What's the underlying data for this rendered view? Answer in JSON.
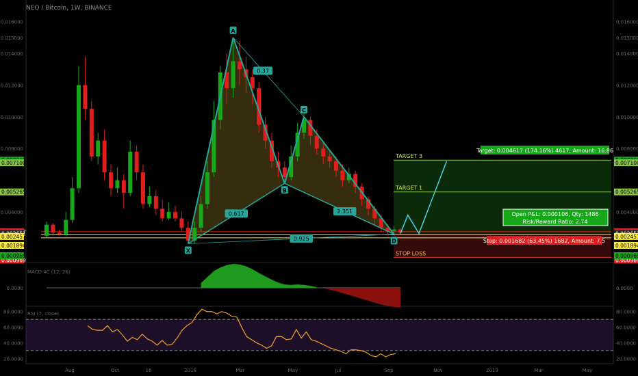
{
  "header": {
    "title": "NEO / Bitcoin, 1W, BINANCE"
  },
  "colors": {
    "up": "#17a81a",
    "down": "#e01e1e",
    "pattern": "#26a69a",
    "target": "#8bc34a",
    "stop": "#e53935",
    "rsi": "#f0a030"
  },
  "chart_data": {
    "type": "candlestick",
    "price_axis": {
      "ylim": [
        0.0009,
        0.0165
      ],
      "ticks": [
        "0.016000",
        "0.015000",
        "0.014000",
        "0.012000",
        "0.010000",
        "0.008000",
        "0.004000",
        "0.002000"
      ]
    },
    "tags_left": [
      {
        "value": "0.007268",
        "y": 0.007268,
        "bg": "#17a81a",
        "fg": "#000"
      },
      {
        "value": "0.007100",
        "y": 0.0071,
        "bg": "#8bc34a",
        "fg": "#000"
      },
      {
        "value": "0.005265",
        "y": 0.005265,
        "bg": "#8bc34a",
        "fg": "#000"
      },
      {
        "value": "0.002757",
        "y": 0.002757,
        "bg": "#e01e1e",
        "fg": "#fff"
      },
      {
        "value": "0.002651",
        "y": 0.002651,
        "bg": "#222",
        "fg": "#fff"
      },
      {
        "value": "0.002457",
        "y": 0.002457,
        "bg": "#ffeb3b",
        "fg": "#000"
      },
      {
        "value": "0.001894",
        "y": 0.001894,
        "bg": "#ffeb3b",
        "fg": "#000"
      },
      {
        "value": "0.000969",
        "y": 0.000969,
        "bg": "#e01e1e",
        "fg": "#fff"
      },
      {
        "value": "0.000969",
        "y": 0.0003,
        "bg": "#17a81a",
        "fg": "#000"
      }
    ],
    "x_ticks": [
      "Aug",
      "Oct",
      "16",
      "2018",
      "Mar",
      "May",
      "Jul",
      "Sep",
      "Nov",
      "2019",
      "Mar",
      "May"
    ],
    "candles": [
      [
        0.0025,
        0.0032,
        0.0034,
        0.0024
      ],
      [
        0.0032,
        0.0027,
        0.0033,
        0.0025
      ],
      [
        0.0027,
        0.0026,
        0.0029,
        0.0025
      ],
      [
        0.0026,
        0.0035,
        0.004,
        0.0025
      ],
      [
        0.0035,
        0.0055,
        0.0062,
        0.0033
      ],
      [
        0.0055,
        0.012,
        0.0132,
        0.0052
      ],
      [
        0.012,
        0.0105,
        0.0138,
        0.0098
      ],
      [
        0.0105,
        0.0075,
        0.011,
        0.0072
      ],
      [
        0.0075,
        0.0085,
        0.009,
        0.007
      ],
      [
        0.0085,
        0.0065,
        0.0092,
        0.006
      ],
      [
        0.0065,
        0.0055,
        0.007,
        0.005
      ],
      [
        0.0055,
        0.006,
        0.0068,
        0.0052
      ],
      [
        0.006,
        0.0052,
        0.0064,
        0.0042
      ],
      [
        0.0052,
        0.0078,
        0.0085,
        0.005
      ],
      [
        0.0078,
        0.0065,
        0.0082,
        0.006
      ],
      [
        0.0065,
        0.0045,
        0.007,
        0.0042
      ],
      [
        0.0045,
        0.005,
        0.0056,
        0.0043
      ],
      [
        0.005,
        0.0042,
        0.0054,
        0.0038
      ],
      [
        0.0042,
        0.0036,
        0.0048,
        0.0034
      ],
      [
        0.0036,
        0.004,
        0.0046,
        0.0035
      ],
      [
        0.004,
        0.0036,
        0.0044,
        0.0034
      ],
      [
        0.0036,
        0.003,
        0.004,
        0.0028
      ],
      [
        0.003,
        0.0022,
        0.0034,
        0.002
      ],
      [
        0.0022,
        0.003,
        0.0034,
        0.002
      ],
      [
        0.003,
        0.0045,
        0.005,
        0.0028
      ],
      [
        0.0045,
        0.0065,
        0.0072,
        0.0042
      ],
      [
        0.0065,
        0.0098,
        0.011,
        0.0062
      ],
      [
        0.0098,
        0.0128,
        0.0132,
        0.0092
      ],
      [
        0.0128,
        0.0118,
        0.014,
        0.0108
      ],
      [
        0.0118,
        0.0135,
        0.015,
        0.0112
      ],
      [
        0.0135,
        0.013,
        0.0148,
        0.012
      ],
      [
        0.013,
        0.0125,
        0.0138,
        0.0115
      ],
      [
        0.0125,
        0.0118,
        0.013,
        0.0108
      ],
      [
        0.0118,
        0.0095,
        0.0122,
        0.009
      ],
      [
        0.0095,
        0.0085,
        0.01,
        0.008
      ],
      [
        0.0085,
        0.0072,
        0.009,
        0.0068
      ],
      [
        0.0072,
        0.0068,
        0.0078,
        0.0062
      ],
      [
        0.0068,
        0.0062,
        0.0072,
        0.0058
      ],
      [
        0.0062,
        0.0075,
        0.0082,
        0.006
      ],
      [
        0.0075,
        0.009,
        0.0096,
        0.0072
      ],
      [
        0.009,
        0.0098,
        0.0102,
        0.0086
      ],
      [
        0.0098,
        0.0088,
        0.01,
        0.0082
      ],
      [
        0.0088,
        0.008,
        0.0092,
        0.0076
      ],
      [
        0.008,
        0.0075,
        0.0084,
        0.007
      ],
      [
        0.0075,
        0.0072,
        0.0078,
        0.0068
      ],
      [
        0.0072,
        0.0066,
        0.0075,
        0.0062
      ],
      [
        0.0066,
        0.006,
        0.007,
        0.0056
      ],
      [
        0.006,
        0.0064,
        0.0068,
        0.0058
      ],
      [
        0.0064,
        0.0056,
        0.0066,
        0.0052
      ],
      [
        0.0056,
        0.0048,
        0.0058,
        0.0044
      ],
      [
        0.0048,
        0.0042,
        0.005,
        0.0038
      ],
      [
        0.0042,
        0.0036,
        0.0044,
        0.0032
      ],
      [
        0.0036,
        0.003,
        0.0038,
        0.0027
      ],
      [
        0.003,
        0.0028,
        0.0032,
        0.0025
      ],
      [
        0.0028,
        0.0029,
        0.0031,
        0.0026
      ],
      [
        0.0029,
        0.0027,
        0.003,
        0.0026
      ]
    ],
    "pattern": {
      "points": [
        {
          "label": "X",
          "i": 22,
          "y": 0.002
        },
        {
          "label": "A",
          "i": 29,
          "y": 0.015
        },
        {
          "label": "B",
          "i": 37,
          "y": 0.0058
        },
        {
          "label": "C",
          "i": 40,
          "y": 0.01
        },
        {
          "label": "D",
          "i": 54,
          "y": 0.0026
        }
      ],
      "ratios": [
        {
          "text": "0.37",
          "pos": [
            0.55,
            0.5
          ],
          "between": [
            "X",
            "B"
          ]
        },
        {
          "text": "0.617",
          "between": [
            "X",
            "B"
          ]
        },
        {
          "text": "2.351",
          "between": [
            "B",
            "D"
          ]
        },
        {
          "text": "0.925",
          "between": [
            "X",
            "D"
          ]
        }
      ]
    },
    "levels": [
      {
        "name": "TARGET 3",
        "y": 0.007268,
        "color": "#8bc34a"
      },
      {
        "name": "TARGET 1",
        "y": 0.005265,
        "color": "#8bc34a"
      },
      {
        "name": "STOP LOSS",
        "y": 0.000969,
        "color": "#e53935"
      }
    ],
    "position": {
      "entry": 0.002651,
      "target_label": "Target: 0.004617 (174.16%) 4617, Amount: 16.86",
      "pnl_label": "Open P&L: 0.000106, Qty: 1486",
      "rr_label": "Risk/Reward Ratio: 2.74",
      "stop_label": "Stop: 0.001682 (63.45%) 1682, Amount: 7.5"
    },
    "projection": [
      [
        0,
        0.002651
      ],
      [
        0.12,
        0.0038
      ],
      [
        0.3,
        0.002651
      ],
      [
        0.75,
        0.0072
      ]
    ],
    "macd": {
      "label": "MACD 4C (12, 26)",
      "tick": "0.0000",
      "values": [
        0,
        0,
        0,
        0,
        0,
        0,
        0,
        0,
        0,
        0,
        0,
        0,
        0,
        0,
        0,
        0,
        0,
        0,
        0,
        0,
        0,
        0,
        0,
        0,
        0.2,
        0.45,
        0.7,
        0.85,
        0.95,
        1.0,
        0.98,
        0.9,
        0.78,
        0.62,
        0.48,
        0.34,
        0.22,
        0.14,
        0.12,
        0.14,
        0.12,
        0.08,
        0.03,
        -0.02,
        -0.08,
        -0.14,
        -0.22,
        -0.3,
        -0.38,
        -0.46,
        -0.54,
        -0.62,
        -0.7,
        -0.76,
        -0.8,
        -0.82
      ]
    },
    "rsi": {
      "label": "RSI (7, close)",
      "ticks": [
        "80.0000",
        "60.0000",
        "40.0000",
        "20.0000"
      ],
      "ylim": [
        15,
        85
      ],
      "upper": 70,
      "lower": 30,
      "values": [
        null,
        null,
        null,
        null,
        null,
        null,
        null,
        null,
        null,
        null,
        null,
        null,
        null,
        null,
        null,
        null,
        null,
        null,
        null,
        null,
        null,
        null,
        null,
        null,
        null,
        null,
        null,
        null,
        null,
        null,
        null,
        null,
        null,
        null,
        null,
        null,
        null,
        null,
        null,
        null,
        null,
        null,
        null,
        null,
        null,
        null,
        null,
        null,
        null,
        null,
        null,
        null,
        null,
        null,
        null,
        null
      ]
    },
    "rsi_line": [
      62,
      57,
      56,
      56,
      62,
      54,
      57,
      50,
      42,
      47,
      44,
      51,
      45,
      42,
      37,
      43,
      37,
      38,
      46,
      56,
      62,
      66,
      76,
      83,
      80,
      80,
      77,
      80,
      78,
      74,
      73,
      60,
      48,
      44,
      40,
      37,
      33,
      36,
      48,
      48,
      44,
      45,
      57,
      46,
      54,
      44,
      42,
      39,
      36,
      33,
      31,
      29,
      26,
      31,
      31,
      30,
      28,
      24,
      22,
      26,
      22,
      25,
      26
    ]
  }
}
